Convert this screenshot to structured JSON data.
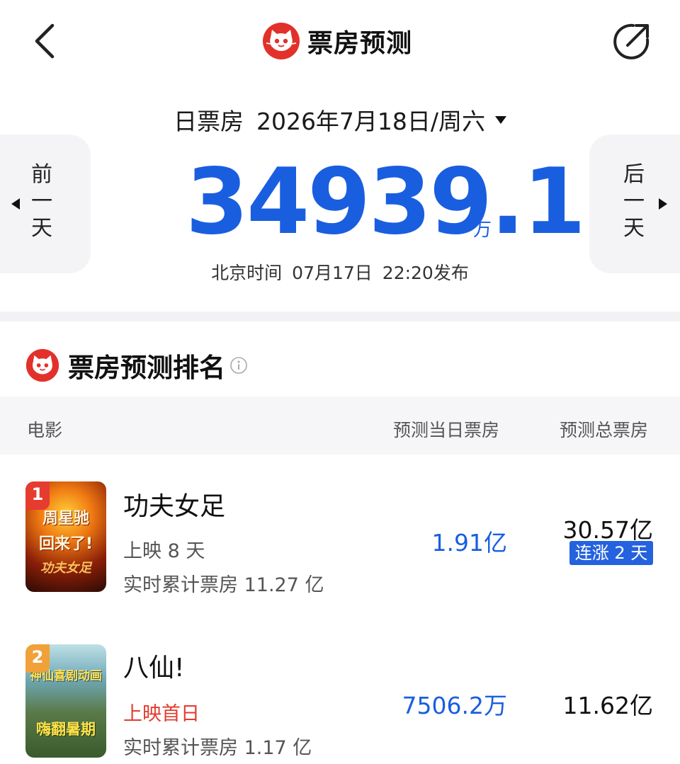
{
  "header": {
    "title": "票房预测",
    "back_icon": "chevron-left-icon",
    "share_icon": "share-icon"
  },
  "date": {
    "label": "日票房",
    "value": "2026年7月18日/周六"
  },
  "nav": {
    "prev_chars": [
      "前",
      "一",
      "天"
    ],
    "next_chars": [
      "后",
      "一",
      "天"
    ]
  },
  "total": {
    "value": "34939.1",
    "unit": "万"
  },
  "publish": {
    "zone": "北京时间",
    "date": "07月17日",
    "time": "22:20发布"
  },
  "ranking": {
    "title": "票房预测排名",
    "columns": {
      "movie": "电影",
      "day": "预测当日票房",
      "total": "预测总票房"
    },
    "movies": [
      {
        "rank": "1",
        "name": "功夫女足",
        "days": "上映 8 天",
        "cumulative": "实时累计票房 11.27 亿",
        "day_box": "1.91亿",
        "total_box": "30.57亿",
        "streak": "连涨 2 天",
        "poster_lines": [
          "周星驰",
          "回来了!",
          "功夫女足"
        ]
      },
      {
        "rank": "2",
        "name": "八仙!",
        "days": "上映首日",
        "cumulative": "实时累计票房 1.17 亿",
        "day_box": "7506.2万",
        "total_box": "11.62亿",
        "poster_lines": [
          "神仙喜剧动画",
          "嗨翻暑期"
        ]
      }
    ]
  },
  "colors": {
    "accent_blue": "#1a5ee0",
    "brand_red": "#e2312a",
    "highlight_red": "#e33b2e"
  }
}
